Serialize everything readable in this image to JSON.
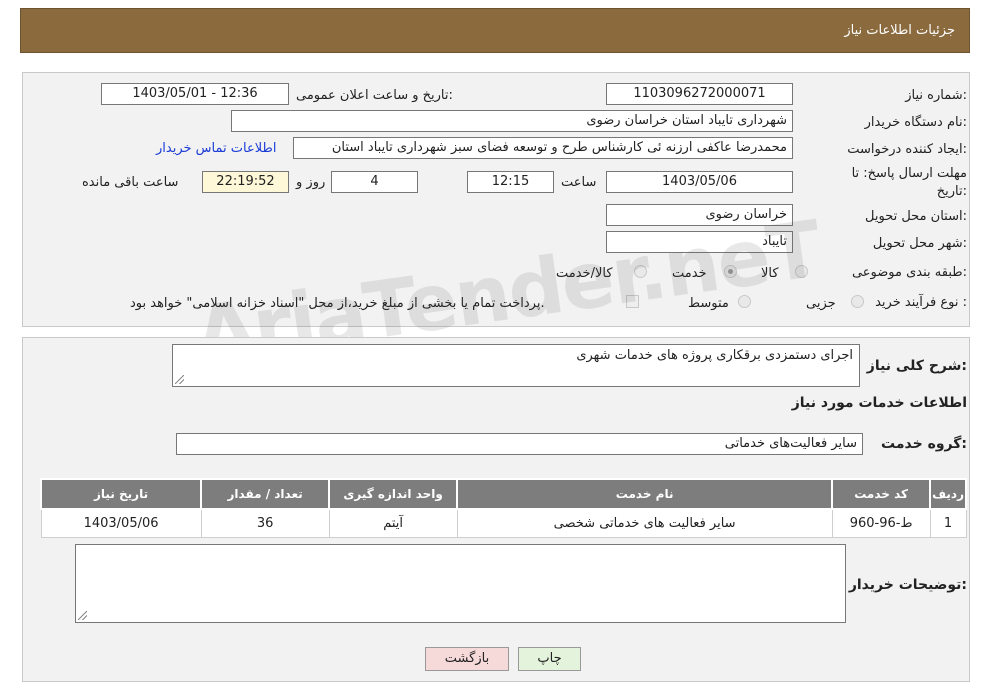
{
  "header": {
    "title": "جزئیات اطلاعات نیاز"
  },
  "form": {
    "need_number_label": "شماره نیاز:",
    "need_number": "1103096272000071",
    "announce_label": "تاریخ و ساعت اعلان عمومی:",
    "announce_value": "1403/05/01 - 12:36",
    "buyer_org_label": "نام دستگاه خریدار:",
    "buyer_org": "شهرداری تایباد استان خراسان رضوی",
    "requester_label": "ایجاد کننده درخواست:",
    "requester": "محمدرضا عاکفی ارزنه ئی کارشناس طرح و توسعه فضای سبز شهرداری تایباد استان",
    "contact_link": "اطلاعات تماس خریدار",
    "deadline_label_line1": "مهلت ارسال پاسخ: تا",
    "deadline_label_line2": "تاریخ:",
    "deadline_date": "1403/05/06",
    "time_label": "ساعت",
    "deadline_time": "12:15",
    "days_value": "4",
    "days_label": "روز و",
    "remaining_time": "22:19:52",
    "remaining_label": "ساعت باقی مانده",
    "province_label": "استان محل تحویل:",
    "province": "خراسان رضوی",
    "city_label": "شهر محل تحویل:",
    "city": "تایباد",
    "category_label": "طبقه بندی موضوعی:",
    "category_options": [
      "کالا",
      "خدمت",
      "کالا/خدمت"
    ],
    "category_selected": "خدمت",
    "process_label": "نوع فرآیند خرید :",
    "process_options": [
      "جزیی",
      "متوسط"
    ],
    "payment_note": "پرداخت تمام یا بخشی از مبلغ خرید،از محل \"اسناد خزانه اسلامی\" خواهد بود."
  },
  "details": {
    "summary_label": "شرح کلی نیاز:",
    "summary": "اجرای دستمزدی برقکاری پروژه های خدمات شهری",
    "services_title": "اطلاعات خدمات مورد نیاز",
    "service_group_label": "گروه خدمت:",
    "service_group": "سایر فعالیت‌های خدماتی",
    "table": {
      "headers": [
        "ردیف",
        "کد خدمت",
        "نام خدمت",
        "واحد اندازه گیری",
        "تعداد / مقدار",
        "تاریخ نیاز"
      ],
      "rows": [
        [
          "1",
          "ط-96-960",
          "سایر فعالیت های خدماتی شخصی",
          "آیتم",
          "36",
          "1403/05/06"
        ]
      ]
    },
    "buyer_notes_label": "توضیحات خریدار:",
    "buyer_notes": ""
  },
  "buttons": {
    "print": "چاپ",
    "back": "بازگشت"
  },
  "colors": {
    "header": "#8b6a3e",
    "table_header": "#7d7d7d",
    "link": "#1a3bd6",
    "back_button": "#f6d9d9",
    "print_button": "#e3f3dc"
  }
}
